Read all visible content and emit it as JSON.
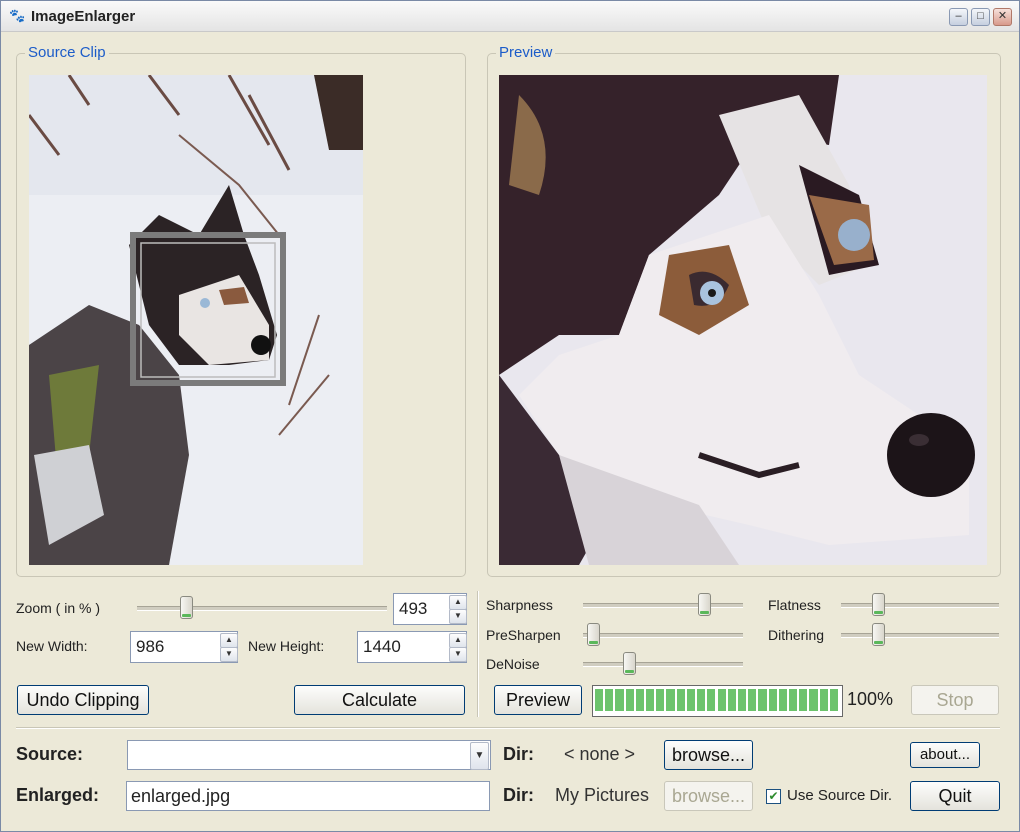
{
  "window": {
    "title": "ImageEnlarger",
    "app_icon": "dog-icon",
    "buttons": {
      "minimize": "minimize-icon",
      "maximize": "maximize-icon",
      "close": "close-icon"
    }
  },
  "source_clip": {
    "title": "Source Clip"
  },
  "preview_panel": {
    "title": "Preview"
  },
  "zoom": {
    "label": "Zoom ( in % )",
    "value": "493",
    "slider_fraction": 0.18
  },
  "new_width": {
    "label": "New Width:",
    "value": "986"
  },
  "new_height": {
    "label": "New Height:",
    "value": "1440"
  },
  "buttons": {
    "undo_clipping": "Undo Clipping",
    "calculate": "Calculate",
    "preview": "Preview",
    "stop": "Stop",
    "browse_source": "browse...",
    "browse_enlarged": "browse...",
    "about": "about...",
    "quit": "Quit"
  },
  "filters": {
    "sharpness": {
      "label": "Sharpness",
      "fraction": 0.78
    },
    "presharpen": {
      "label": "PreSharpen",
      "fraction": 0.03
    },
    "denoise": {
      "label": "DeNoise",
      "fraction": 0.27
    },
    "flatness": {
      "label": "Flatness",
      "fraction": 0.21
    },
    "dithering": {
      "label": "Dithering",
      "fraction": 0.21
    }
  },
  "progress": {
    "percent_text": "100%",
    "fraction": 1.0,
    "segments": 24,
    "color": "#6cc36c"
  },
  "source": {
    "label": "Source:",
    "value": "",
    "dir_label": "Dir:",
    "dir_value": "< none >"
  },
  "enlarged": {
    "label": "Enlarged:",
    "value": "enlarged.jpg",
    "dir_label": "Dir:",
    "dir_value": "My Pictures"
  },
  "use_source_dir": {
    "label": "Use Source Dir.",
    "checked": true
  },
  "colors": {
    "accent": "#1c5cc9",
    "window_bg": "#ece9d8",
    "progress": "#6cc36c"
  }
}
